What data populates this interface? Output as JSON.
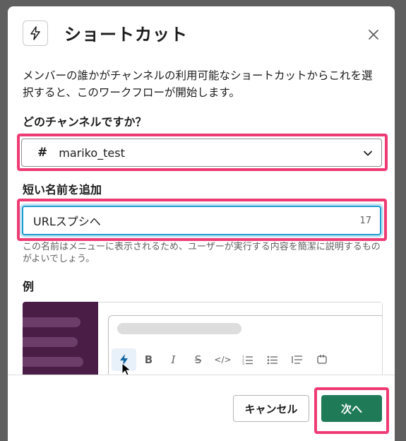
{
  "modal": {
    "title": "ショートカット",
    "description": "メンバーの誰かがチャンネルの利用可能なショートカットからこれを選択すると、このワークフローが開始します。"
  },
  "channel": {
    "label": "どのチャンネルですか？",
    "prefix": "#",
    "value": "mariko_test"
  },
  "short_name": {
    "label": "短い名前を追加",
    "value": "URLスプシへ",
    "remaining": "17",
    "hint": "この名前はメニューに表示されるため、ユーザーが実行する内容を簡潔に説明するものがよいでしょう。"
  },
  "example": {
    "label": "例",
    "toolbar": {
      "bold": "B",
      "italic": "I",
      "strike": "S",
      "code": "</>"
    }
  },
  "footer": {
    "cancel_label": "キャンセル",
    "next_label": "次へ"
  },
  "colors": {
    "primary": "#1f7a58",
    "focus": "#1d9bd1",
    "highlight": "#ef3b74",
    "sidebar": "#4a1d47"
  }
}
